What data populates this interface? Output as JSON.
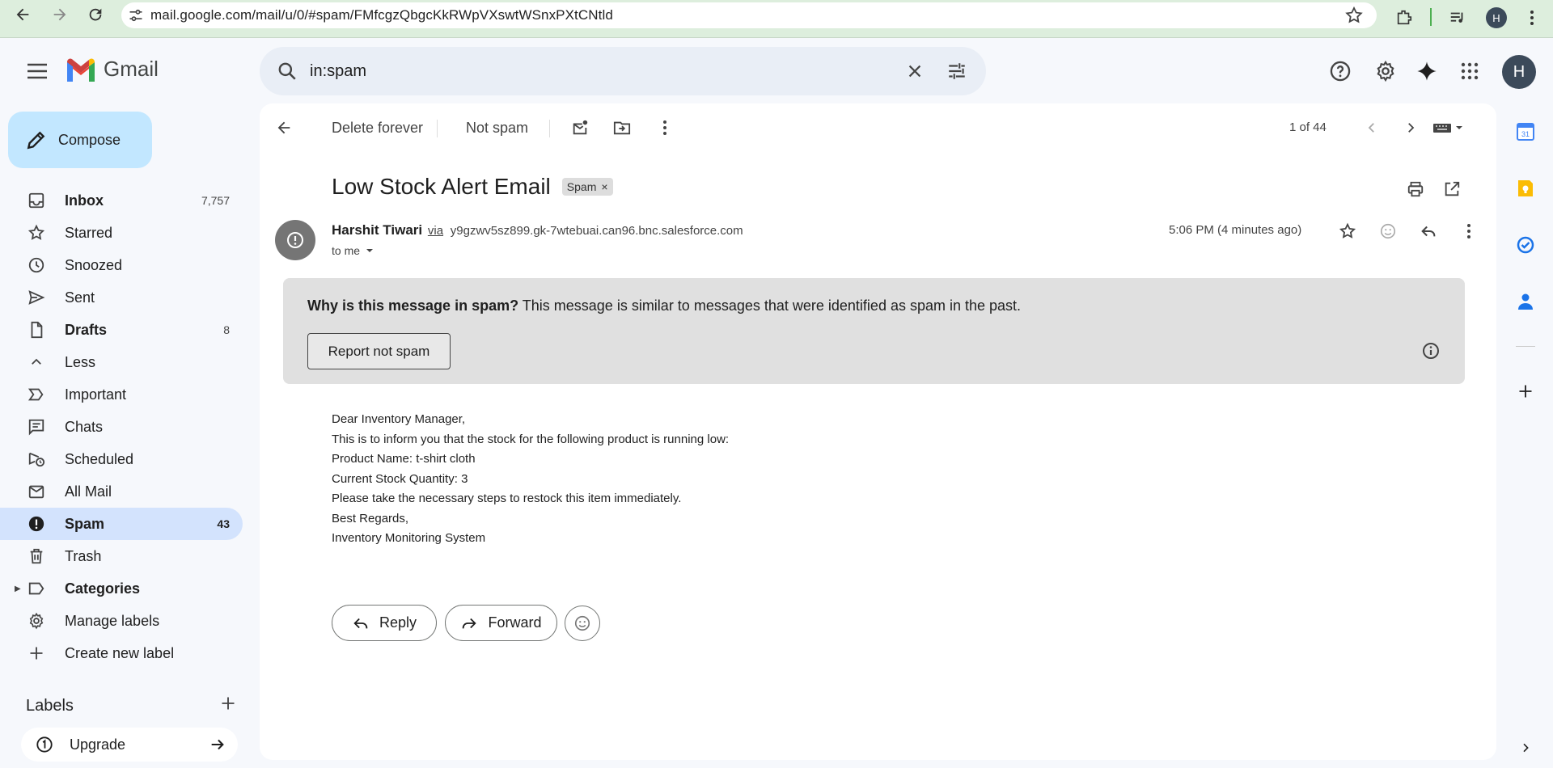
{
  "browser": {
    "url": "mail.google.com/mail/u/0/#spam/FMfcgzQbgcKkRWpVXswtWSnxPXtCNtld",
    "profile_initial": "H"
  },
  "header": {
    "app_name": "Gmail",
    "search_query": "in:spam",
    "account_initial": "H"
  },
  "sidebar": {
    "compose_label": "Compose",
    "items": [
      {
        "label": "Inbox",
        "count": "7,757",
        "icon": "inbox-icon"
      },
      {
        "label": "Starred",
        "count": "",
        "icon": "star-icon"
      },
      {
        "label": "Snoozed",
        "count": "",
        "icon": "clock-icon"
      },
      {
        "label": "Sent",
        "count": "",
        "icon": "send-icon"
      },
      {
        "label": "Drafts",
        "count": "8",
        "icon": "draft-icon"
      },
      {
        "label": "Less",
        "count": "",
        "icon": "chevron-up-icon"
      },
      {
        "label": "Important",
        "count": "",
        "icon": "important-icon"
      },
      {
        "label": "Chats",
        "count": "",
        "icon": "chat-icon"
      },
      {
        "label": "Scheduled",
        "count": "",
        "icon": "scheduled-send-icon"
      },
      {
        "label": "All Mail",
        "count": "",
        "icon": "all-mail-icon"
      },
      {
        "label": "Spam",
        "count": "43",
        "icon": "spam-icon"
      },
      {
        "label": "Trash",
        "count": "",
        "icon": "trash-icon"
      },
      {
        "label": "Categories",
        "count": "",
        "icon": "label-icon"
      },
      {
        "label": "Manage labels",
        "count": "",
        "icon": "gear-icon"
      },
      {
        "label": "Create new label",
        "count": "",
        "icon": "plus-icon"
      }
    ],
    "labels_heading": "Labels",
    "upgrade_label": "Upgrade"
  },
  "toolbar": {
    "delete_forever": "Delete forever",
    "not_spam": "Not spam",
    "pager": "1 of 44"
  },
  "message": {
    "subject": "Low Stock Alert Email",
    "tag": "Spam",
    "sender_name": "Harshit Tiwari",
    "via": "via",
    "sender_address": "y9gzwv5sz899.gk-7wtebuai.can96.bnc.salesforce.com",
    "to": "to me",
    "time": "5:06 PM (4 minutes ago)",
    "spam_warning_title": "Why is this message in spam?",
    "spam_warning_text": " This message is similar to messages that were identified as spam in the past.",
    "report_not_spam": "Report not spam",
    "body": [
      "Dear Inventory Manager,",
      "This is to inform you that the stock for the following product is running low:",
      "Product Name: t-shirt cloth",
      "Current Stock Quantity: 3",
      "Please take the necessary steps to restock this item immediately.",
      "Best Regards,",
      "Inventory Monitoring System"
    ],
    "reply_label": "Reply",
    "forward_label": "Forward"
  },
  "colors": {
    "compose_bg": "#c2e7ff",
    "active_nav": "#d3e3fd",
    "search_bg": "#e9eef6",
    "page_bg": "#f6f8fc"
  }
}
